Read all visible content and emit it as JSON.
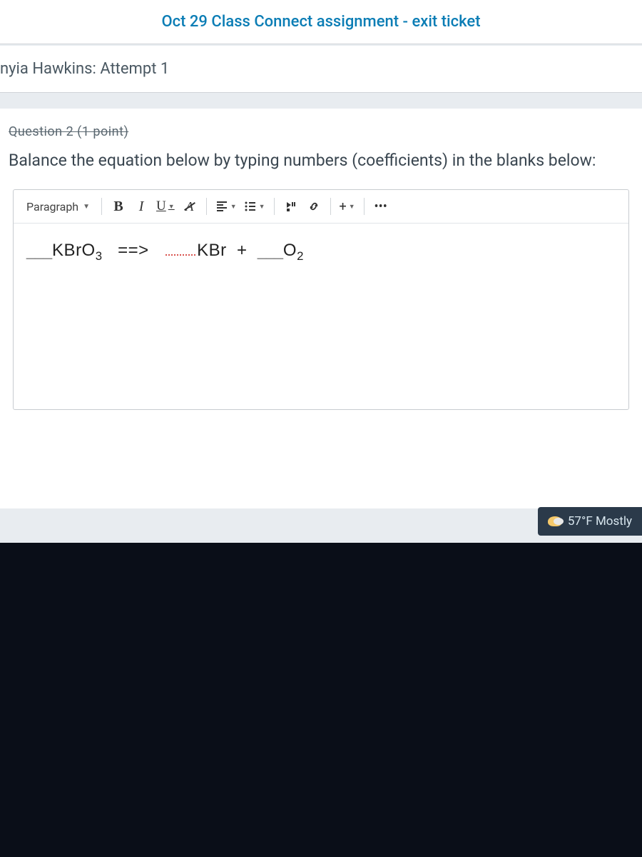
{
  "header": {
    "title": "Oct 29 Class Connect assignment - exit ticket"
  },
  "attempt": {
    "text": "nyia Hawkins: Attempt 1"
  },
  "question": {
    "header_cut": "Question 2 (1 point)",
    "prompt": "Balance the equation below by typing numbers (coefficients) in the blanks below:"
  },
  "toolbar": {
    "paragraph": "Paragraph",
    "bold": "B",
    "italic": "I",
    "underline": "U",
    "clear": "A",
    "plus": "+",
    "more": "•••"
  },
  "equation": {
    "blank": "___",
    "reactant1": "KBrO",
    "reactant1_sub": "3",
    "arrow": "==>",
    "product1": "KBr",
    "plus": "+",
    "product2": "O",
    "product2_sub": "2"
  },
  "weather": {
    "text": "57°F  Mostly"
  }
}
